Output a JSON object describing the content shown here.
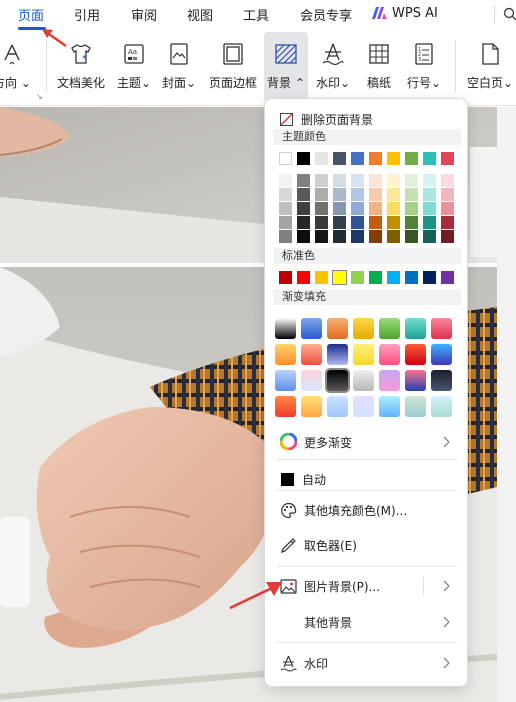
{
  "menubar": {
    "tabs": [
      "页面",
      "引用",
      "审阅",
      "视图",
      "工具",
      "会员专享"
    ],
    "active_tab": "页面",
    "wps_ai": "WPS AI"
  },
  "ribbon": {
    "orientation": "方向",
    "doc_beautify": "文档美化",
    "theme": "主题",
    "cover": "封面",
    "page_border": "页面边框",
    "background": "背景",
    "watermark": "水印",
    "manuscript": "稿纸",
    "line_numbers": "行号",
    "blank_page": "空白页"
  },
  "dropdown": {
    "remove_bg": "删除页面背景",
    "theme_colors_title": "主题颜色",
    "theme_top_row": [
      "#ffffff",
      "#000000",
      "#e7e6e6",
      "#44546a",
      "#4472c4",
      "#ed7d31",
      "#ffc000",
      "#70ad47",
      "#2ec0b8",
      "#e0465a"
    ],
    "theme_shade_columns": [
      [
        "#f2f2f2",
        "#d8d8d8",
        "#bfbfbf",
        "#a5a5a5",
        "#7f7f7f"
      ],
      [
        "#7f7f7f",
        "#595959",
        "#3f3f3f",
        "#262626",
        "#0d0d0d"
      ],
      [
        "#d0cece",
        "#aeabab",
        "#757070",
        "#3a3838",
        "#171616"
      ],
      [
        "#d6dce4",
        "#adb9ca",
        "#8496b0",
        "#323f4f",
        "#222a35"
      ],
      [
        "#d9e2f3",
        "#b4c6e7",
        "#8eaadb",
        "#2f5496",
        "#1f3864"
      ],
      [
        "#fbe5d5",
        "#f7cbac",
        "#f4b183",
        "#c55a11",
        "#833c0b"
      ],
      [
        "#fff2cc",
        "#fee599",
        "#ffd966",
        "#bf9000",
        "#7f6000"
      ],
      [
        "#e2efd9",
        "#c5e0b3",
        "#a8d08d",
        "#538135",
        "#375623"
      ],
      [
        "#d5f3f1",
        "#aae7e3",
        "#80dbd5",
        "#22908a",
        "#16605c"
      ],
      [
        "#f9dade",
        "#f3b5bd",
        "#ec909c",
        "#a82c3c",
        "#701d28"
      ]
    ],
    "standard_title": "标准色",
    "standard_colors": [
      "#c00000",
      "#ff0000",
      "#ffc000",
      "#ffff00",
      "#92d050",
      "#00b050",
      "#00b0f0",
      "#0070c0",
      "#002060",
      "#7030a0"
    ],
    "gradient_title": "渐变填充",
    "gradients": [
      [
        "#ffffff",
        "#000000"
      ],
      [
        "#7fa6ea",
        "#2a5bd0"
      ],
      [
        "#f7b077",
        "#e06d1d"
      ],
      [
        "#ffd84a",
        "#e6a800"
      ],
      [
        "#9bdc7a",
        "#4ea52d"
      ],
      [
        "#6fe0d0",
        "#1aa394"
      ],
      [
        "#f7889a",
        "#de3050"
      ],
      [
        "#ffd36b",
        "#ff8c2e"
      ],
      [
        "#ffb090",
        "#f04e42"
      ],
      [
        "#1d2b8a",
        "#b0b8f0"
      ],
      [
        "#fff07a",
        "#f8d72a"
      ],
      [
        "#ff9ec0",
        "#ff4e7d"
      ],
      [
        "#ff5c3c",
        "#c90010"
      ],
      [
        "#3ab4ff",
        "#4035b8"
      ],
      [
        "#b8d2ff",
        "#5f8fe8"
      ],
      [
        "#ffd0dc",
        "#d7e8ff"
      ],
      [
        "#000000",
        "#5a5a5a"
      ],
      [
        "#f0f0f0",
        "#b6b6b6"
      ],
      [
        "#c7a7f4",
        "#f79ad5"
      ],
      [
        "#ff6d8a",
        "#2342b6"
      ],
      [
        "#1b1f2e",
        "#4b5670"
      ],
      [
        "#ff8a42",
        "#ee3b2b"
      ],
      [
        "#ffe07a",
        "#ffa542"
      ],
      [
        "#cce2ff",
        "#9fc6ff"
      ],
      [
        "#e6dcff",
        "#cfe4ff"
      ],
      [
        "#a8f0f8",
        "#64b0ff"
      ],
      [
        "#cfe7d2",
        "#9cc9d2"
      ],
      [
        "#d6f1ff",
        "#a8dcd2"
      ]
    ],
    "more_gradients": "更多渐变",
    "automatic": "自动",
    "other_fill": "其他填充颜色(M)...",
    "color_picker": "取色器(E)",
    "picture_bg": "图片背景(P)...",
    "other_bg": "其他背景",
    "watermark": "水印",
    "colors": {
      "accent": "#1a56db",
      "selected_item": "#e3e5e9",
      "arrow": "#e53935"
    }
  }
}
